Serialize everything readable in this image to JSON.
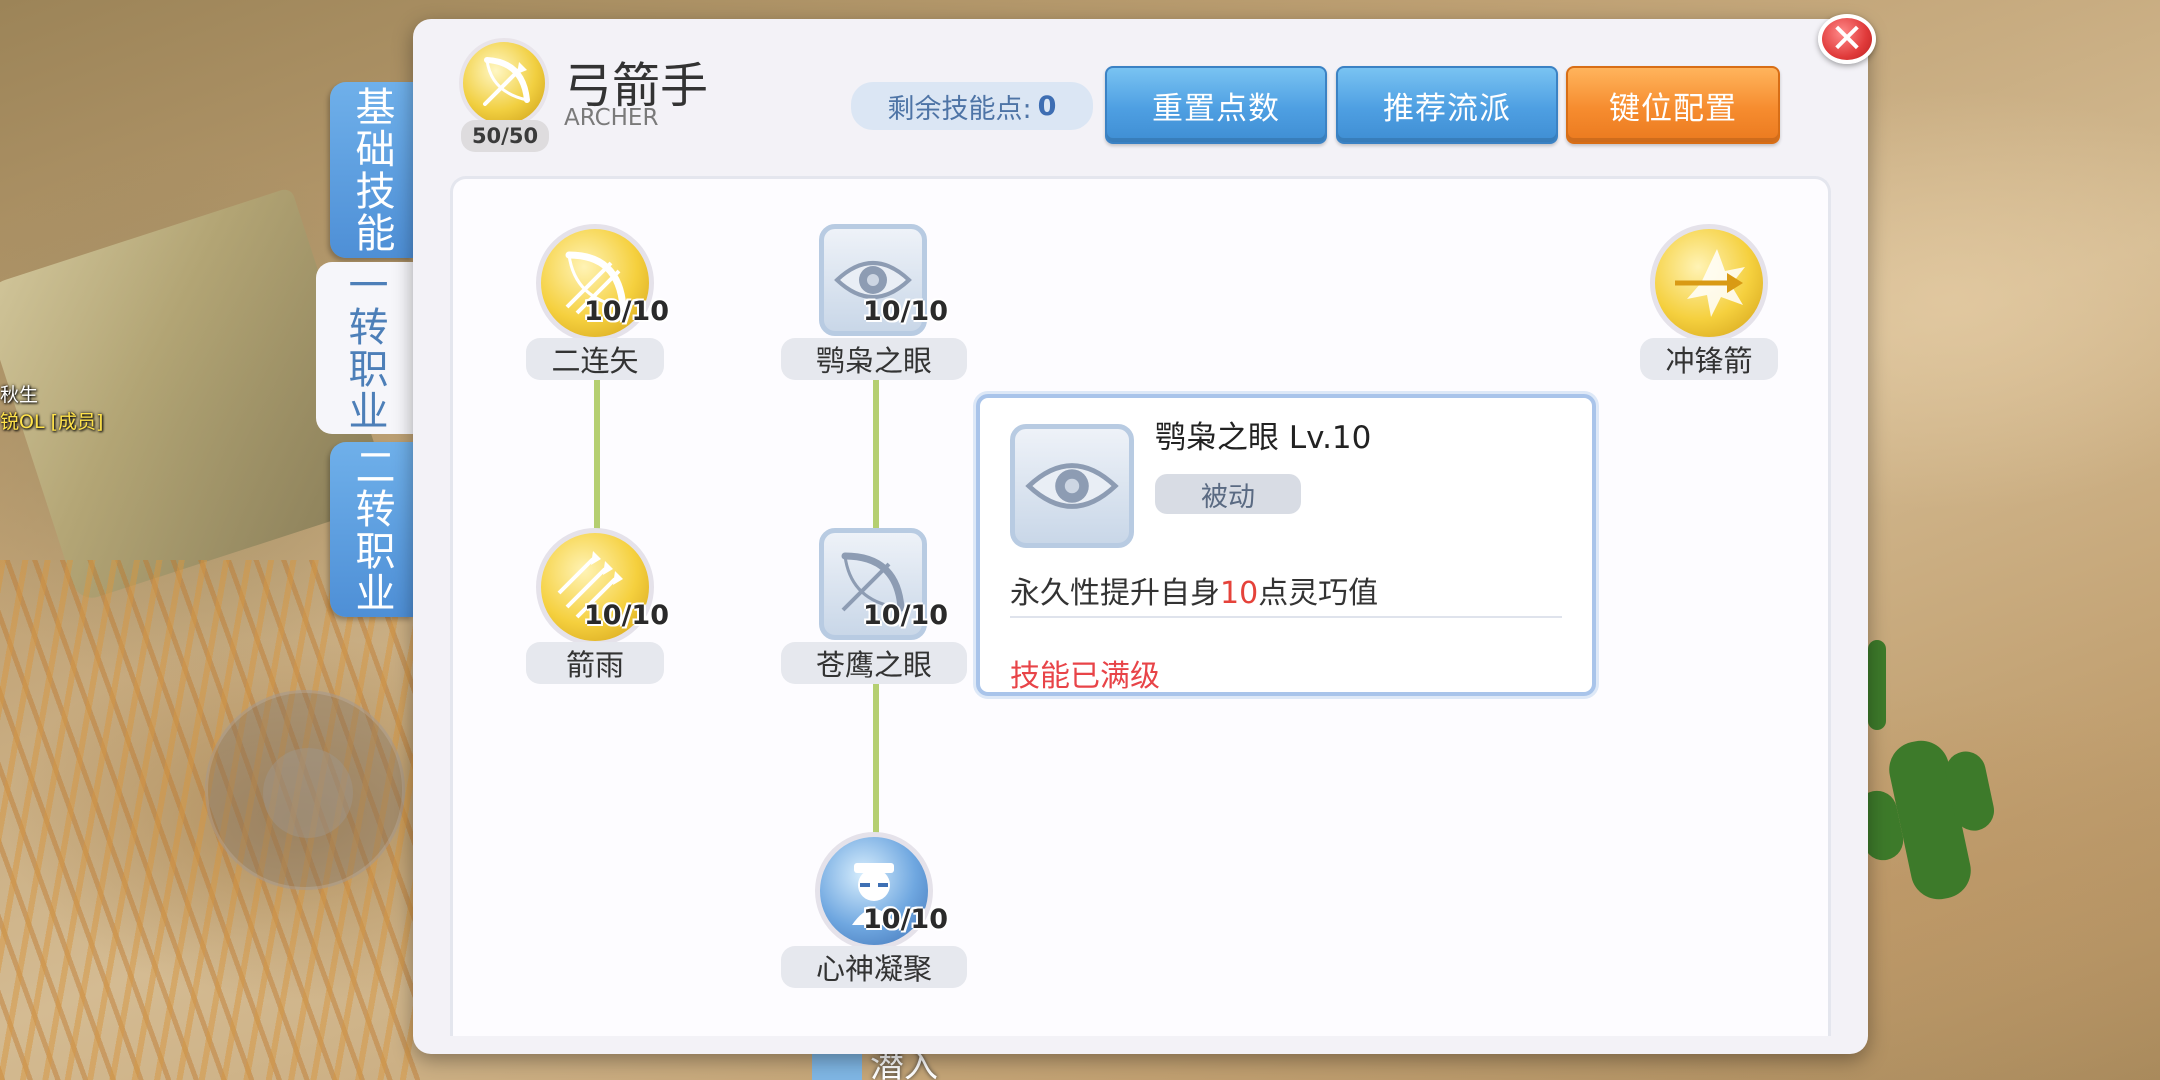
{
  "world": {
    "left_labels": [
      "秋生",
      "锐OL [成员]"
    ],
    "bottom_name": "潜入"
  },
  "side_tabs": [
    {
      "label": "基础技能",
      "active": false
    },
    {
      "label": "一转职业",
      "active": true
    },
    {
      "label": "二转职业",
      "active": false
    }
  ],
  "header": {
    "class_name": "弓箭手",
    "class_name_en": "ARCHER",
    "class_level": "50/50",
    "points_label": "剩余技能点:",
    "points_value": "0",
    "buttons": {
      "reset": "重置点数",
      "recommend": "推荐流派",
      "keybind": "键位配置"
    },
    "close_glyph": "✕"
  },
  "skills": [
    {
      "name": "二连矢",
      "level": "10/10",
      "icon": "double-arrow-bow-icon"
    },
    {
      "name": "鹗枭之眼",
      "level": "10/10",
      "icon": "owl-eye-icon"
    },
    {
      "name": "冲锋箭",
      "level": "",
      "icon": "charge-arrow-icon"
    },
    {
      "name": "箭雨",
      "level": "10/10",
      "icon": "arrow-rain-icon"
    },
    {
      "name": "苍鹰之眼",
      "level": "10/10",
      "icon": "hawk-eye-icon"
    },
    {
      "name": "心神凝聚",
      "level": "10/10",
      "icon": "concentration-icon"
    }
  ],
  "tooltip": {
    "title": "鹗枭之眼 Lv.10",
    "tag": "被动",
    "desc_before": "永久性提升自身",
    "desc_value": "10",
    "desc_after": "点灵巧值",
    "status": "技能已满级"
  },
  "colors": {
    "accent_blue": "#4e9fe2",
    "accent_orange": "#f68c2f",
    "connector": "#b5cf71",
    "max_level_red": "#e84448"
  }
}
